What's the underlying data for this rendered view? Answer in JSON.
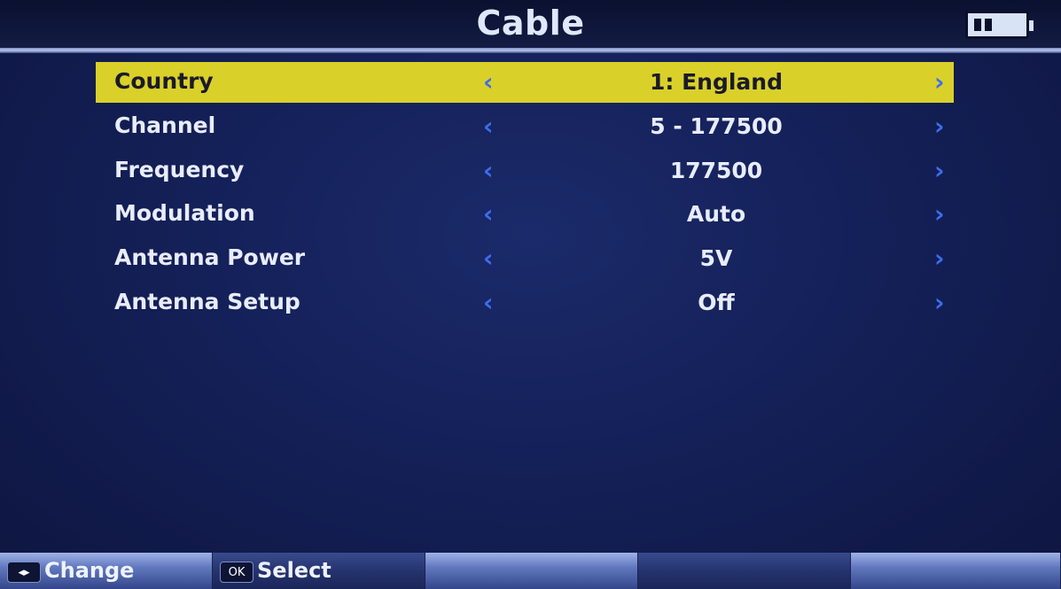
{
  "header": {
    "title": "Cable",
    "battery_icon": "battery-icon"
  },
  "menu": {
    "selected_index": 0,
    "highlight_color": "#d9d02a",
    "arrow_color": "#3b6ff0",
    "items": [
      {
        "label": "Country",
        "value": "1: England"
      },
      {
        "label": "Channel",
        "value": "5 - 177500"
      },
      {
        "label": "Frequency",
        "value": "177500"
      },
      {
        "label": "Modulation",
        "value": "Auto"
      },
      {
        "label": "Antenna Power",
        "value": "5V"
      },
      {
        "label": "Antenna Setup",
        "value": "Off"
      }
    ]
  },
  "footer": {
    "change": {
      "key": "◂▸",
      "label": "Change"
    },
    "select": {
      "key": "OK",
      "label": "Select"
    }
  }
}
